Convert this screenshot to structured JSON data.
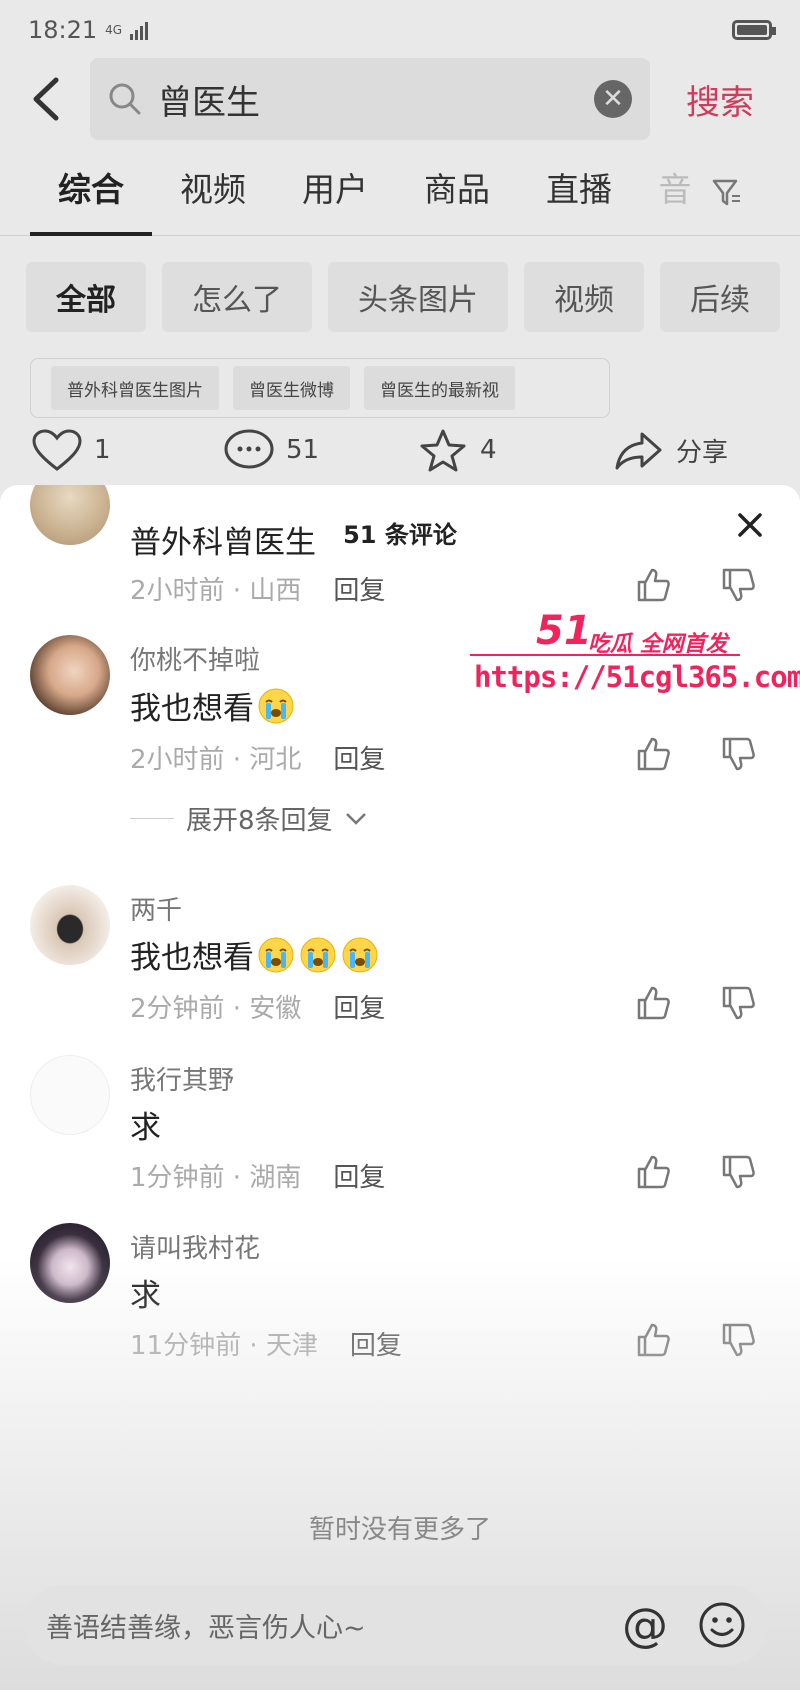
{
  "status": {
    "time": "18:21",
    "signal": "4G"
  },
  "search": {
    "query": "曾医生",
    "button": "搜索"
  },
  "tabs": [
    {
      "label": "综合",
      "active": true
    },
    {
      "label": "视频"
    },
    {
      "label": "用户"
    },
    {
      "label": "商品"
    },
    {
      "label": "直播"
    },
    {
      "label": "音"
    }
  ],
  "chips": [
    "全部",
    "怎么了",
    "头条图片",
    "视频",
    "后续"
  ],
  "related": [
    "普外科曾医生图片",
    "曾医生微博",
    "曾医生的最新视"
  ],
  "actions": {
    "likes": "1",
    "comments": "51",
    "favorites": "4",
    "share": "分享"
  },
  "sheet": {
    "title": "51 条评论"
  },
  "comments": [
    {
      "name": "",
      "text": "普外科曾医生",
      "time": "2小时前 · 山西",
      "reply": "回复"
    },
    {
      "name": "你桃不掉啦",
      "text": "我也想看",
      "time": "2小时前 · 河北",
      "reply": "回复",
      "expand": "展开8条回复"
    },
    {
      "name": "两千",
      "text": "我也想看",
      "time": "2分钟前 · 安徽",
      "reply": "回复"
    },
    {
      "name": "我行其野",
      "text": "求",
      "time": "1分钟前 · 湖南",
      "reply": "回复"
    },
    {
      "name": "请叫我村花",
      "text": "求",
      "time": "11分钟前 · 天津",
      "reply": "回复"
    }
  ],
  "no_more": "暂时没有更多了",
  "input": {
    "placeholder": "善语结善缘，恶言伤人心~"
  },
  "watermark": {
    "brand": "51",
    "tagline": "吃瓜 全网首发",
    "url": "https://51cgl365.com"
  }
}
